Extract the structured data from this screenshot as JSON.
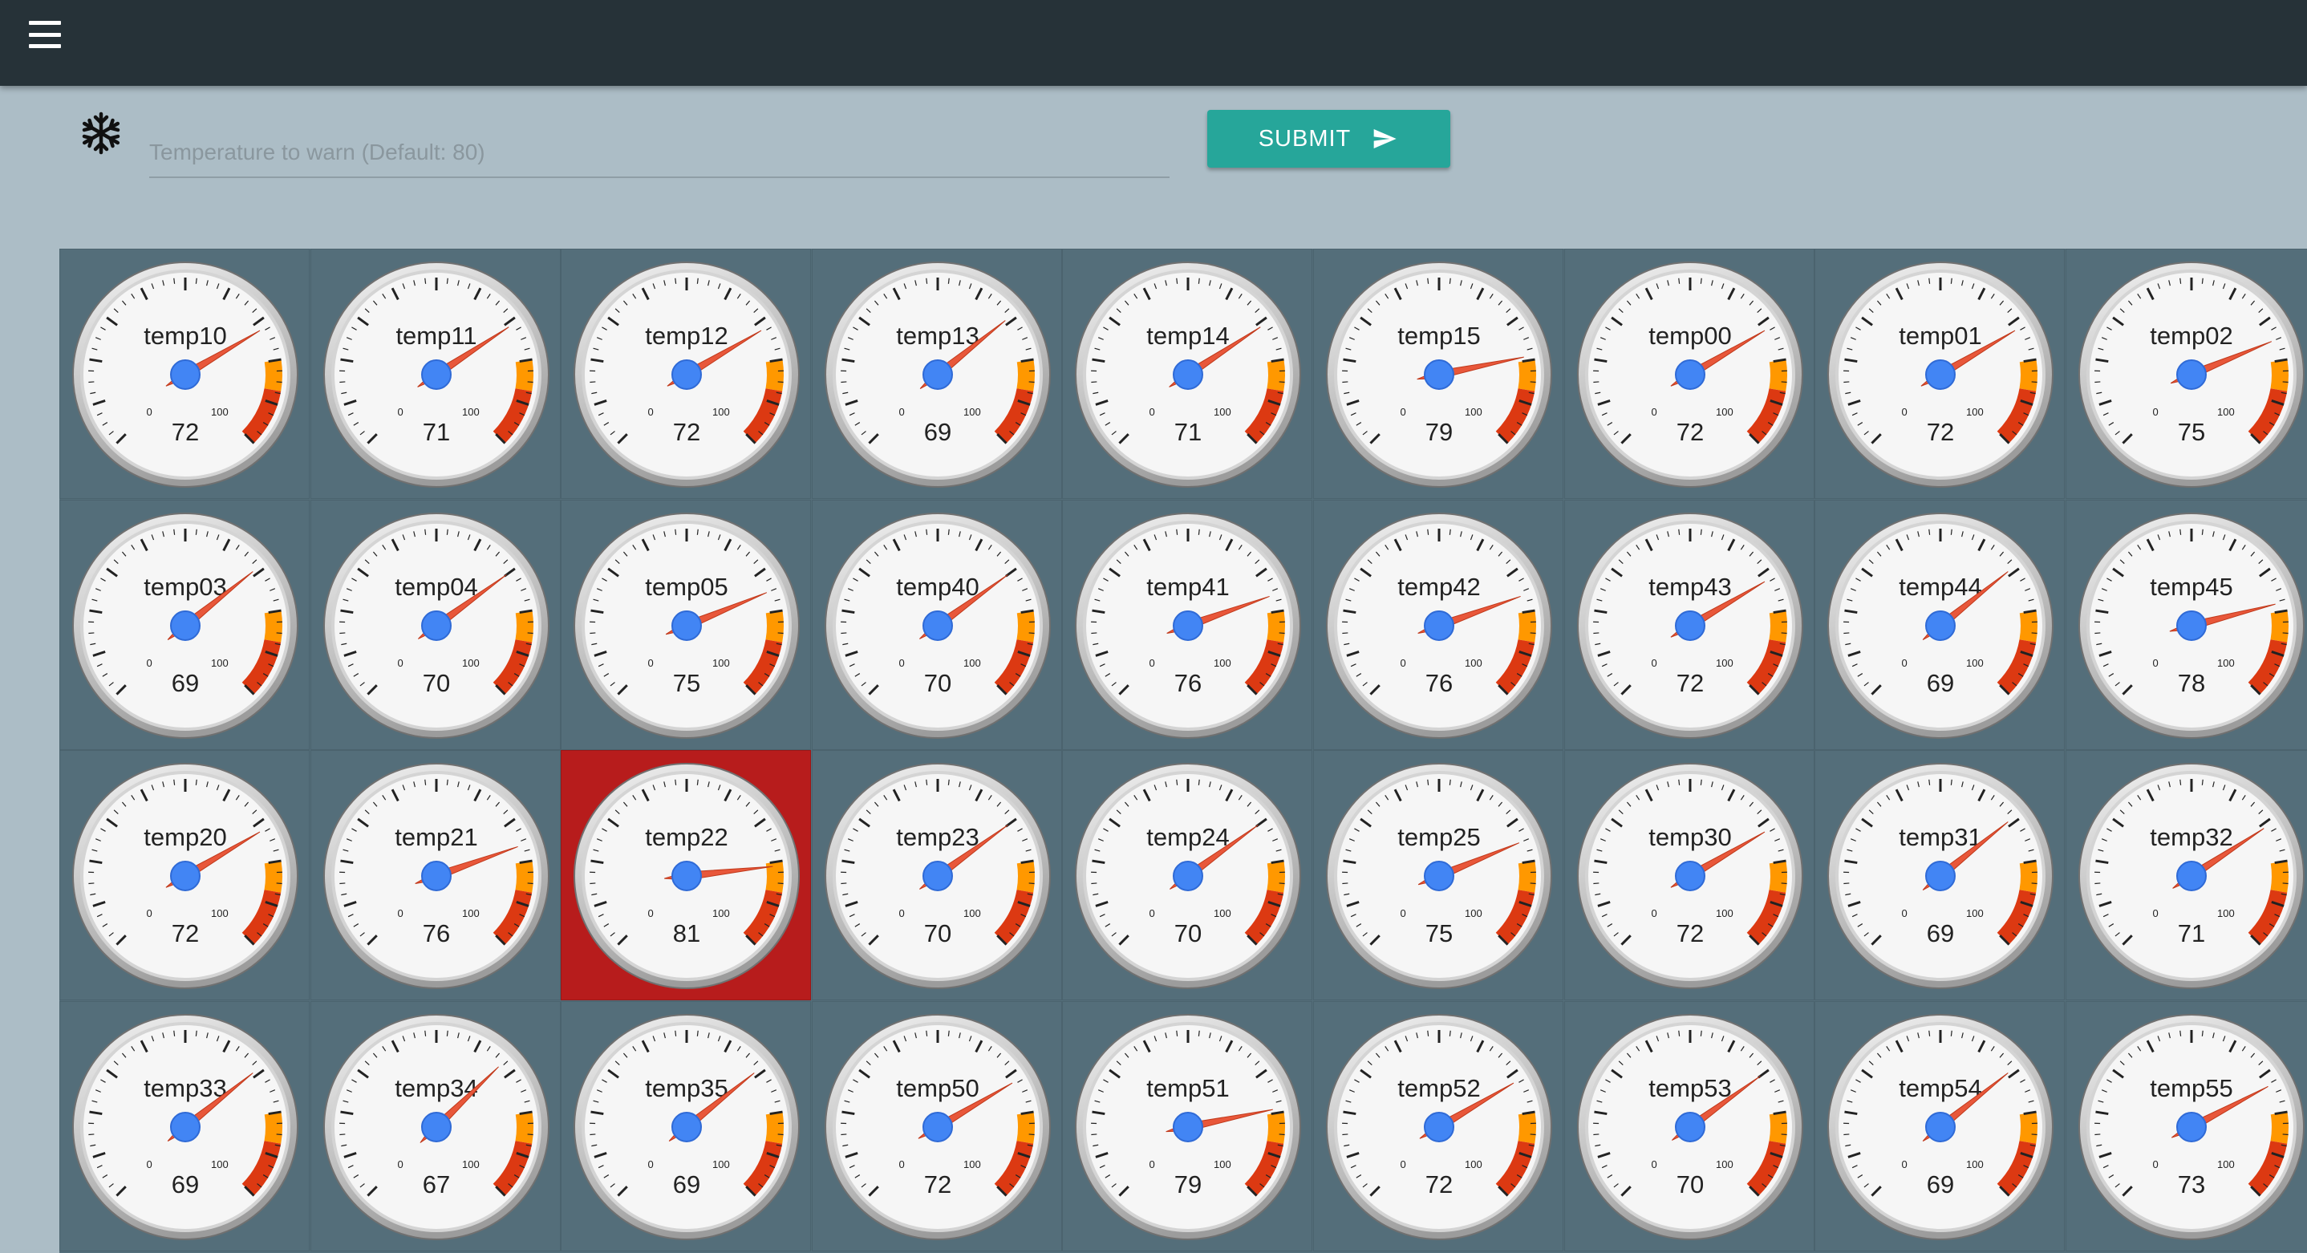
{
  "header": {
    "menu_icon": "menu-icon"
  },
  "form": {
    "icon": "snowflake-icon",
    "placeholder": "Temperature to warn (Default: 80)",
    "value": "",
    "submit_label": "SUBMIT",
    "submit_icon": "send-icon"
  },
  "gauge_scale": {
    "min": 0,
    "max": 100,
    "min_label": "0",
    "max_label": "100",
    "warn_threshold": 80
  },
  "colors": {
    "appbar": "#263238",
    "panel": "#546e7a",
    "alert": "#b71c1c",
    "accent": "#26a69a",
    "needle": "#e8573a",
    "hub": "#4285f4"
  },
  "gauges": [
    {
      "name": "temp10",
      "value": 72
    },
    {
      "name": "temp11",
      "value": 71
    },
    {
      "name": "temp12",
      "value": 72
    },
    {
      "name": "temp13",
      "value": 69
    },
    {
      "name": "temp14",
      "value": 71
    },
    {
      "name": "temp15",
      "value": 79
    },
    {
      "name": "temp00",
      "value": 72
    },
    {
      "name": "temp01",
      "value": 72
    },
    {
      "name": "temp02",
      "value": 75
    },
    {
      "name": "temp03",
      "value": 69
    },
    {
      "name": "temp04",
      "value": 70
    },
    {
      "name": "temp05",
      "value": 75
    },
    {
      "name": "temp40",
      "value": 70
    },
    {
      "name": "temp41",
      "value": 76
    },
    {
      "name": "temp42",
      "value": 76
    },
    {
      "name": "temp43",
      "value": 72
    },
    {
      "name": "temp44",
      "value": 69
    },
    {
      "name": "temp45",
      "value": 78
    },
    {
      "name": "temp20",
      "value": 72
    },
    {
      "name": "temp21",
      "value": 76
    },
    {
      "name": "temp22",
      "value": 81,
      "alert": true
    },
    {
      "name": "temp23",
      "value": 70
    },
    {
      "name": "temp24",
      "value": 70
    },
    {
      "name": "temp25",
      "value": 75
    },
    {
      "name": "temp30",
      "value": 72
    },
    {
      "name": "temp31",
      "value": 69
    },
    {
      "name": "temp32",
      "value": 71
    },
    {
      "name": "temp33",
      "value": 69
    },
    {
      "name": "temp34",
      "value": 67
    },
    {
      "name": "temp35",
      "value": 69
    },
    {
      "name": "temp50",
      "value": 72
    },
    {
      "name": "temp51",
      "value": 79
    },
    {
      "name": "temp52",
      "value": 72
    },
    {
      "name": "temp53",
      "value": 70
    },
    {
      "name": "temp54",
      "value": 69
    },
    {
      "name": "temp55",
      "value": 73
    }
  ]
}
